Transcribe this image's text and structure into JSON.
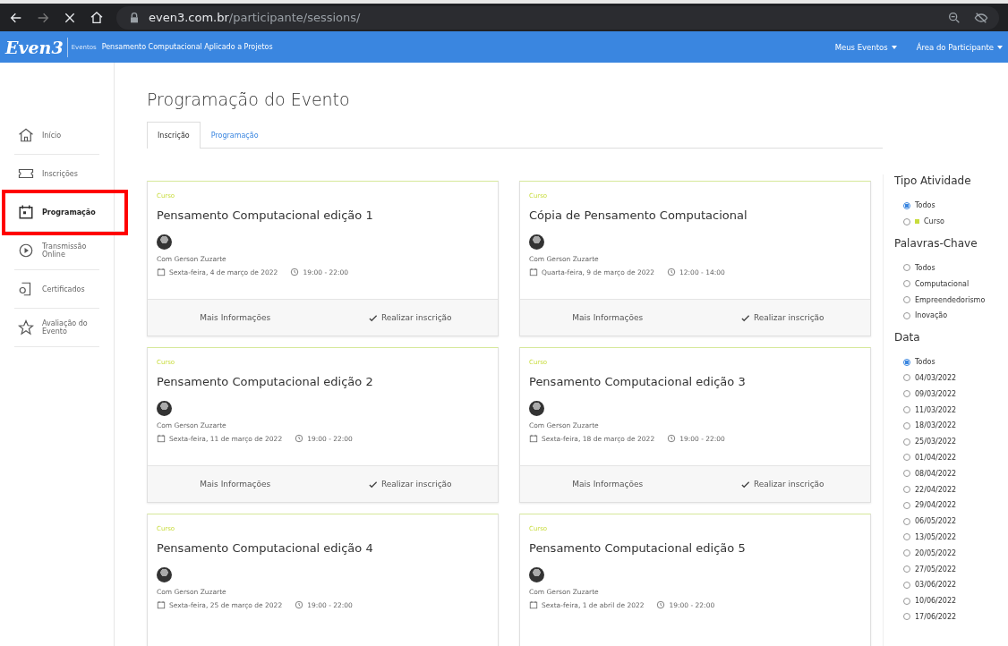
{
  "browser": {
    "url_host": "even3.com.br",
    "url_path": "/participante/sessions/"
  },
  "navbar": {
    "logo": "Even3",
    "section": "Eventos",
    "event_title": "Pensamento Computacional Aplicado a Projetos",
    "menus": [
      "Meus Eventos",
      "Área do Participante"
    ]
  },
  "sidebar": {
    "items": [
      {
        "kind": "home",
        "label": "Início",
        "selected": false,
        "highlighted": false
      },
      {
        "kind": "ticket",
        "label": "Inscrições",
        "selected": false,
        "highlighted": false
      },
      {
        "kind": "calendar",
        "label": "Programação",
        "selected": true,
        "highlighted": true
      },
      {
        "kind": "play",
        "label": "Transmissão Online",
        "selected": false,
        "highlighted": false
      },
      {
        "kind": "certificate",
        "label": "Certificados",
        "selected": false,
        "highlighted": false
      },
      {
        "kind": "star",
        "label": "Avaliação do Evento",
        "selected": false,
        "highlighted": false
      }
    ]
  },
  "page_title": "Programação do Evento",
  "tabs": [
    {
      "label": "Inscrição",
      "selected": true
    },
    {
      "label": "Programação",
      "selected": false
    }
  ],
  "cards": [
    {
      "tag": "Curso",
      "title": "Pensamento Computacional edição 1",
      "speaker": "Com Gerson Zuzarte",
      "date": "Sexta-feira, 4 de março de 2022",
      "time": "19:00 - 22:00",
      "actions": [
        "Mais Informações",
        "Realizar inscrição"
      ]
    },
    {
      "tag": "Curso",
      "title": "Cópia de Pensamento Computacional",
      "speaker": "Com Gerson Zuzarte",
      "date": "Quarta-feira, 9 de março de 2022",
      "time": "12:00 - 14:00",
      "actions": [
        "Mais Informações",
        "Realizar inscrição"
      ]
    },
    {
      "tag": "Curso",
      "title": "Pensamento Computacional edição 2",
      "speaker": "Com Gerson Zuzarte",
      "date": "Sexta-feira, 11 de março de 2022",
      "time": "19:00 - 22:00",
      "actions": [
        "Mais Informações",
        "Realizar inscrição"
      ]
    },
    {
      "tag": "Curso",
      "title": "Pensamento Computacional edição 3",
      "speaker": "Com Gerson Zuzarte",
      "date": "Sexta-feira, 18 de março de 2022",
      "time": "19:00 - 22:00",
      "actions": [
        "Mais Informações",
        "Realizar inscrição"
      ]
    },
    {
      "tag": "Curso",
      "title": "Pensamento Computacional edição 4",
      "speaker": "Com Gerson Zuzarte",
      "date": "Sexta-feira, 25 de março de 2022",
      "time": "19:00 - 22:00"
    },
    {
      "tag": "Curso",
      "title": "Pensamento Computacional edição 5",
      "speaker": "Com Gerson Zuzarte",
      "date": "Sexta-feira, 1 de abril de 2022",
      "time": "19:00 - 22:00"
    }
  ],
  "filters": [
    {
      "title": "Tipo Atividade",
      "options": [
        {
          "label": "Todos",
          "selected": true
        },
        {
          "label": "Curso",
          "selected": false,
          "color": "#c8dc3c"
        }
      ]
    },
    {
      "title": "Palavras-Chave",
      "options": [
        {
          "label": "Todos",
          "selected": false
        },
        {
          "label": "Computacional",
          "selected": false
        },
        {
          "label": "Empreendedorismo",
          "selected": false
        },
        {
          "label": "Inovação",
          "selected": false
        }
      ]
    },
    {
      "title": "Data",
      "options": [
        {
          "label": "Todos",
          "selected": true
        },
        {
          "label": "04/03/2022",
          "selected": false
        },
        {
          "label": "09/03/2022",
          "selected": false
        },
        {
          "label": "11/03/2022",
          "selected": false
        },
        {
          "label": "18/03/2022",
          "selected": false
        },
        {
          "label": "25/03/2022",
          "selected": false
        },
        {
          "label": "01/04/2022",
          "selected": false
        },
        {
          "label": "08/04/2022",
          "selected": false
        },
        {
          "label": "22/04/2022",
          "selected": false
        },
        {
          "label": "29/04/2022",
          "selected": false
        },
        {
          "label": "06/05/2022",
          "selected": false
        },
        {
          "label": "13/05/2022",
          "selected": false
        },
        {
          "label": "20/05/2022",
          "selected": false
        },
        {
          "label": "27/05/2022",
          "selected": false
        },
        {
          "label": "03/06/2022",
          "selected": false
        },
        {
          "label": "10/06/2022",
          "selected": false
        },
        {
          "label": "17/06/2022",
          "selected": false
        }
      ]
    }
  ]
}
